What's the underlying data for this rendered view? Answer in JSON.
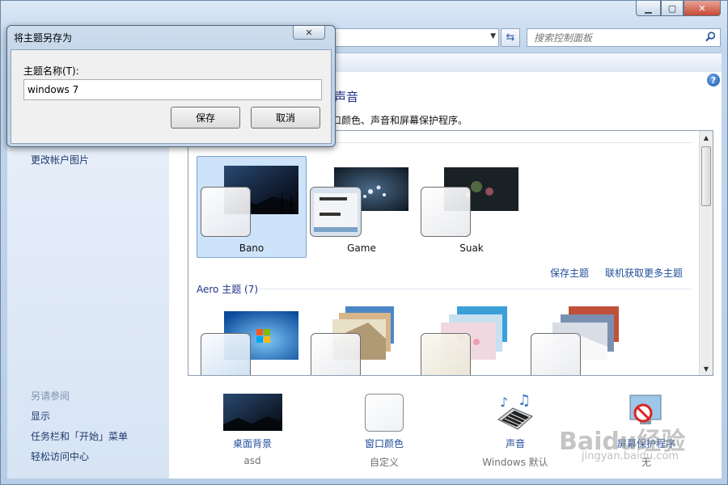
{
  "window": {
    "min_label": "▁",
    "max_label": "▢",
    "close_label": "✕"
  },
  "address_bar": {
    "dropdown_glyph": "▼",
    "refresh_glyph": "⇆"
  },
  "search": {
    "placeholder": "搜索控制面板",
    "icon": "search-icon"
  },
  "help_label": "?",
  "sidebar": {
    "change_picture": "更改帐户图片",
    "see_also_header": "另请参阅",
    "see_also": [
      "显示",
      "任务栏和「开始」菜单",
      "轻松访问中心"
    ]
  },
  "main": {
    "title": "和声音",
    "description": "窗口颜色、声音和屏幕保护程序。"
  },
  "themes": {
    "my_themes": [
      {
        "name": "Bano",
        "selected": true
      },
      {
        "name": "Game",
        "selected": false
      },
      {
        "name": "Suak",
        "selected": false
      }
    ],
    "save_theme_link": "保存主题",
    "online_more_link": "联机获取更多主题",
    "aero_group_title": "Aero 主题 (7)"
  },
  "bottom_bar": [
    {
      "label": "桌面背景",
      "sub": "asd",
      "icon": "desktop-background-icon"
    },
    {
      "label": "窗口颜色",
      "sub": "自定义",
      "icon": "window-color-icon"
    },
    {
      "label": "声音",
      "sub": "Windows 默认",
      "icon": "sound-icon"
    },
    {
      "label": "屏幕保护程序",
      "sub": "无",
      "icon": "screensaver-icon"
    }
  ],
  "dialog": {
    "title": "将主题另存为",
    "close_label": "✕",
    "field_label": "主题名称(T):",
    "field_value": "windows 7",
    "save_button": "保存",
    "cancel_button": "取消"
  },
  "watermark": {
    "main": "Baidu经验",
    "sub": "jingyan.baidu.com"
  },
  "colors": {
    "link": "#1f4d9a",
    "heading": "#1e3287",
    "selection": "#cde3f9"
  }
}
